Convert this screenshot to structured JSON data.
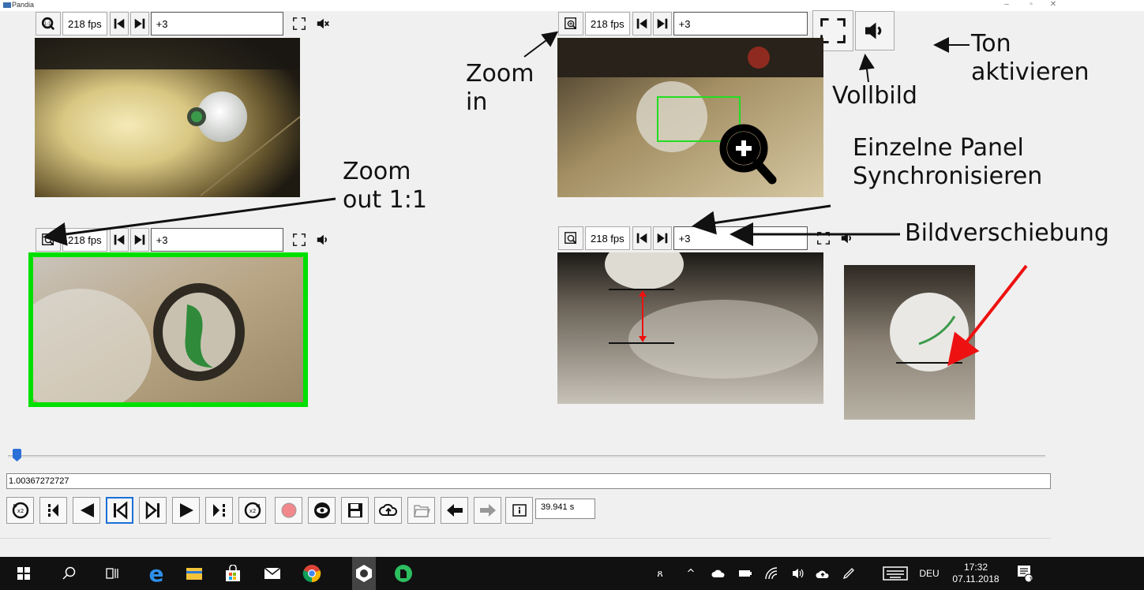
{
  "window": {
    "title": "Pandia"
  },
  "panels": [
    {
      "name": "top-left",
      "fps": "218 fps",
      "offset": "+3",
      "sound": "muted",
      "zoom": "fit"
    },
    {
      "name": "top-right",
      "fps": "218 fps",
      "offset": "+3",
      "sound": "on",
      "zoom": "zoom-in"
    },
    {
      "name": "bottom-left",
      "fps": "218 fps",
      "offset": "+3",
      "sound": "on",
      "zoom": "zoom-in"
    },
    {
      "name": "bottom-right",
      "fps": "218 fps",
      "offset": "+3",
      "sound": "on",
      "zoom": "zoom-in"
    }
  ],
  "annotations": {
    "zoom_in": [
      "Zoom",
      "in"
    ],
    "zoom_out": [
      "Zoom",
      "out 1:1"
    ],
    "vollbild": "Vollbild",
    "ton": [
      "Ton",
      "aktivieren"
    ],
    "sync": [
      "Einzelne Panel",
      "Synchronisieren"
    ],
    "bildverschiebung": "Bildverschiebung"
  },
  "timeline": {
    "value": "1.00367272727",
    "position_fraction": 0.0
  },
  "transport": {
    "time": "39.941 s"
  },
  "taskbar": {
    "language": "DEU",
    "time": "17:32",
    "date": "07.11.2018",
    "notification_count": "1"
  },
  "colors": {
    "highlight_green": "#00e000",
    "annotation_red": "#ee1111",
    "taskbar": "#111111"
  }
}
